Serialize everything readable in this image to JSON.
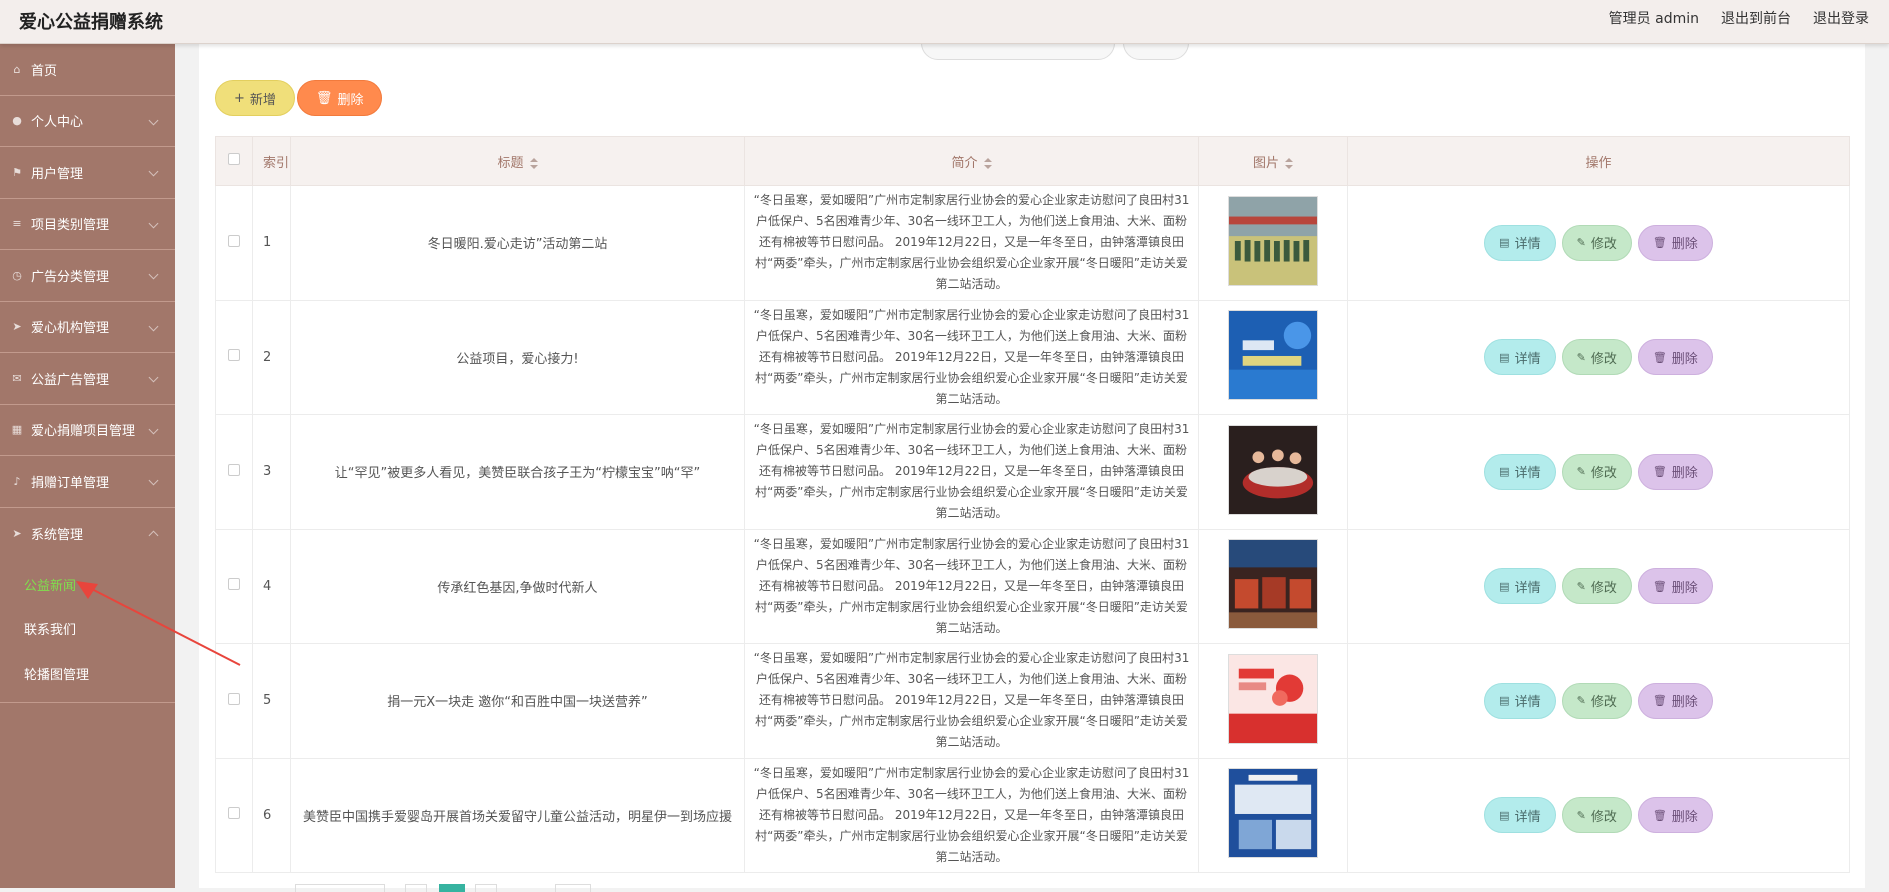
{
  "app": {
    "title": "爱心公益捐赠系统"
  },
  "top_links": {
    "admin": "管理员 admin",
    "to_front": "退出到前台",
    "logout": "退出登录"
  },
  "sidebar": {
    "items": [
      {
        "label": "首页",
        "icon": "home-icon"
      },
      {
        "label": "个人中心",
        "icon": "user-icon"
      },
      {
        "label": "用户管理",
        "icon": "flag-icon"
      },
      {
        "label": "项目类别管理",
        "icon": "list-icon"
      },
      {
        "label": "广告分类管理",
        "icon": "clock-icon"
      },
      {
        "label": "爱心机构管理",
        "icon": "send-icon"
      },
      {
        "label": "公益广告管理",
        "icon": "mail-icon"
      },
      {
        "label": "爱心捐赠项目管理",
        "icon": "grid-icon"
      },
      {
        "label": "捐赠订单管理",
        "icon": "mic-icon"
      },
      {
        "label": "系统管理",
        "icon": "send-icon"
      }
    ],
    "sub_items": [
      {
        "label": "公益新闻",
        "active": true
      },
      {
        "label": "联系我们",
        "active": false
      },
      {
        "label": "轮播图管理",
        "active": false
      }
    ]
  },
  "toolbar": {
    "add_label": "新增",
    "delete_label": "删除"
  },
  "table": {
    "headers": {
      "index": "索引",
      "title": "标题",
      "intro": "简介",
      "image": "图片",
      "actions": "操作"
    },
    "row_actions": {
      "detail": "详情",
      "edit": "修改",
      "delete": "删除"
    },
    "rows": [
      {
        "index": "1",
        "title": "冬日暖阳.爱心走访”活动第二站",
        "intro": "“冬日虽寒，爱如暖阳”广州市定制家居行业协会的爱心企业家走访慰问了良田村31户低保户、5名困难青少年、30名一线环卫工人，为他们送上食用油、大米、面粉还有棉被等节日慰问品。 2019年12月22日，又是一年冬至日，由钟落潭镇良田村“两委”牵头，广州市定制家居行业协会组织爱心企业家开展“冬日暖阳”走访关爱第二站活动。"
      },
      {
        "index": "2",
        "title": "公益项目，爱心接力!",
        "intro": "“冬日虽寒，爱如暖阳”广州市定制家居行业协会的爱心企业家走访慰问了良田村31户低保户、5名困难青少年、30名一线环卫工人，为他们送上食用油、大米、面粉还有棉被等节日慰问品。 2019年12月22日，又是一年冬至日，由钟落潭镇良田村“两委”牵头，广州市定制家居行业协会组织爱心企业家开展“冬日暖阳”走访关爱第二站活动。"
      },
      {
        "index": "3",
        "title": "让“罕见”被更多人看见，美赞臣联合孩子王为“柠檬宝宝”呐“罕”",
        "intro": "“冬日虽寒，爱如暖阳”广州市定制家居行业协会的爱心企业家走访慰问了良田村31户低保户、5名困难青少年、30名一线环卫工人，为他们送上食用油、大米、面粉还有棉被等节日慰问品。 2019年12月22日，又是一年冬至日，由钟落潭镇良田村“两委”牵头，广州市定制家居行业协会组织爱心企业家开展“冬日暖阳”走访关爱第二站活动。"
      },
      {
        "index": "4",
        "title": "传承红色基因,争做时代新人",
        "intro": "“冬日虽寒，爱如暖阳”广州市定制家居行业协会的爱心企业家走访慰问了良田村31户低保户、5名困难青少年、30名一线环卫工人，为他们送上食用油、大米、面粉还有棉被等节日慰问品。 2019年12月22日，又是一年冬至日，由钟落潭镇良田村“两委”牵头，广州市定制家居行业协会组织爱心企业家开展“冬日暖阳”走访关爱第二站活动。"
      },
      {
        "index": "5",
        "title": "捐一元X一块走 邀你“和百胜中国一块送营养”",
        "intro": "“冬日虽寒，爱如暖阳”广州市定制家居行业协会的爱心企业家走访慰问了良田村31户低保户、5名困难青少年、30名一线环卫工人，为他们送上食用油、大米、面粉还有棉被等节日慰问品。 2019年12月22日，又是一年冬至日，由钟落潭镇良田村“两委”牵头，广州市定制家居行业协会组织爱心企业家开展“冬日暖阳”走访关爱第二站活动。"
      },
      {
        "index": "6",
        "title": "美赞臣中国携手爱婴岛开展首场关爱留守儿童公益活动，明星伊一到场应援",
        "intro": "“冬日虽寒，爱如暖阳”广州市定制家居行业协会的爱心企业家走访慰问了良田村31户低保户、5名困难青少年、30名一线环卫工人，为他们送上食用油、大米、面粉还有棉被等节日慰问品。 2019年12月22日，又是一年冬至日，由钟落潭镇良田村“两委”牵头，广州市定制家居行业协会组织爱心企业家开展“冬日暖阳”走访关爱第二站活动。"
      }
    ]
  },
  "colors": {
    "sidebar_bg": "#a2776a",
    "active_sub": "#7fe04d",
    "header_text": "#a2776a",
    "add_btn": "#f0df7a",
    "delete_btn": "#ff8a4d",
    "detail_btn": "#b3ecec",
    "edit_btn": "#c5e8c9",
    "row_delete_btn": "#dcc3ea",
    "annotation_arrow": "#e8453c"
  }
}
